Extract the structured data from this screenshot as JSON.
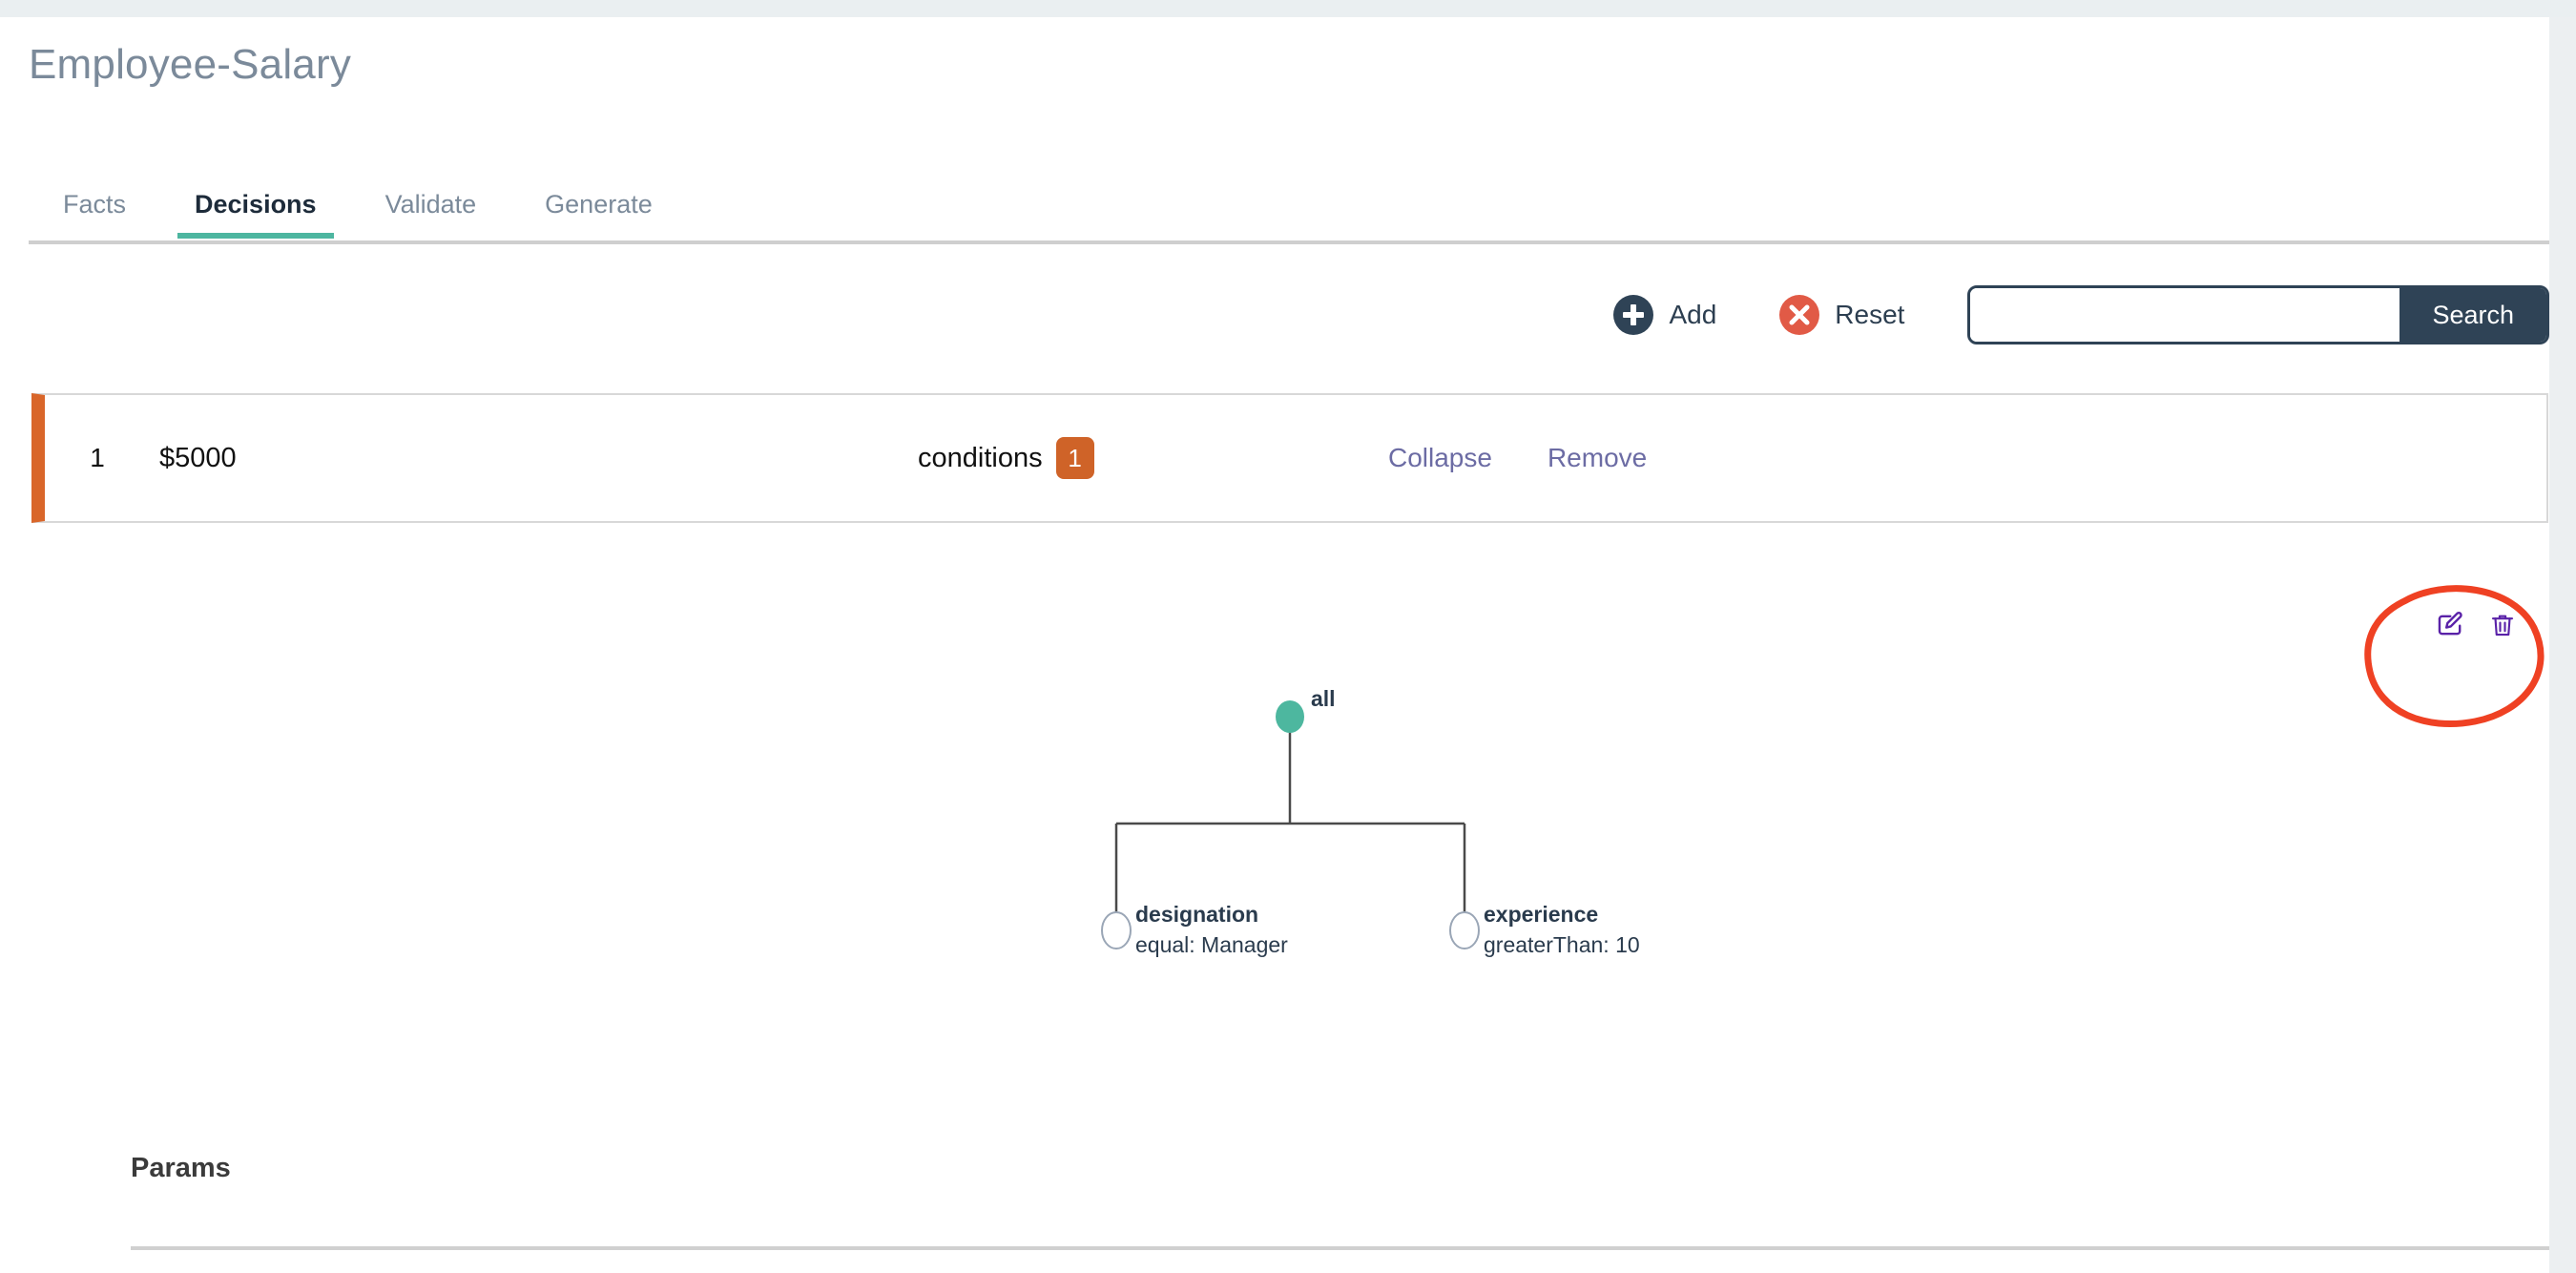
{
  "header": {
    "title": "Employee-Salary"
  },
  "tabs": [
    {
      "label": "Facts",
      "active": false
    },
    {
      "label": "Decisions",
      "active": true
    },
    {
      "label": "Validate",
      "active": false
    },
    {
      "label": "Generate",
      "active": false
    }
  ],
  "toolbar": {
    "add_label": "Add",
    "add_icon": "plus-circle-icon",
    "reset_label": "Reset",
    "reset_icon": "x-circle-icon",
    "search_value": "",
    "search_placeholder": "",
    "search_button_label": "Search"
  },
  "decision_row": {
    "index": "1",
    "value": "$5000",
    "conditions_label": "conditions",
    "conditions_count": "1",
    "collapse_label": "Collapse",
    "remove_label": "Remove"
  },
  "node_actions": {
    "edit_icon": "edit-pencil-icon",
    "delete_icon": "trash-icon"
  },
  "annotation": {
    "shape": "hand-drawn-circle",
    "color": "#ef4123"
  },
  "tree": {
    "root": {
      "label": "all",
      "filled": true
    },
    "children": [
      {
        "name": "designation",
        "condition": "equal: Manager"
      },
      {
        "name": "experience",
        "condition": "greaterThan: 10"
      }
    ]
  },
  "params": {
    "title": "Params"
  },
  "colors": {
    "accent_green": "#4db6a0",
    "title_gray": "#7b8a9a",
    "navy": "#2f4356",
    "reset_red": "#e15a46",
    "badge_orange": "#cf6328",
    "row_bar_orange": "#d9662a",
    "link_purple": "#6c6ca4",
    "icon_purple": "#5a22a8",
    "annotation_red": "#ef4123",
    "node_green": "#4db79f"
  }
}
